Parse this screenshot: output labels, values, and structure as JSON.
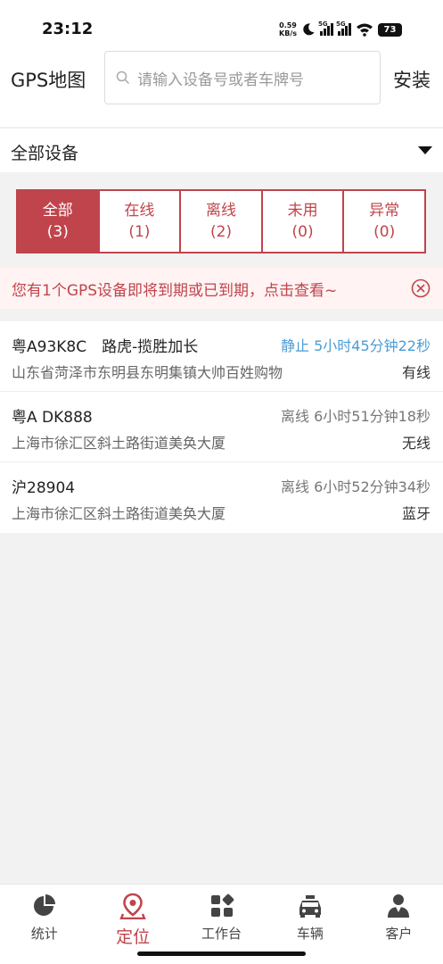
{
  "status_bar": {
    "time": "23:12",
    "net_speed_value": "0.59",
    "net_speed_unit": "KB/s",
    "signal_1": "5G",
    "signal_2": "5G",
    "battery": "73"
  },
  "header": {
    "title": "GPS地图",
    "search_placeholder": "请输入设备号或者车牌号",
    "install_label": "安装"
  },
  "device_filter": {
    "label": "全部设备"
  },
  "tabs": [
    {
      "label": "全部",
      "count": "(3)",
      "active": true
    },
    {
      "label": "在线",
      "count": "(1)",
      "active": false
    },
    {
      "label": "离线",
      "count": "(2)",
      "active": false
    },
    {
      "label": "未用",
      "count": "(0)",
      "active": false
    },
    {
      "label": "异常",
      "count": "(0)",
      "active": false
    }
  ],
  "notice": {
    "text": "您有1个GPS设备即将到期或已到期，点击查看~"
  },
  "devices": [
    {
      "plate": "粤A93K8C　路虎-揽胜加长",
      "status": "静止 5小时45分钟22秒",
      "address": "山东省菏泽市东明县东明集镇大帅百姓购物",
      "connection": "有线"
    },
    {
      "plate": "粤A DK888",
      "status": "离线 6小时51分钟18秒",
      "address": "上海市徐汇区斜土路街道美奂大厦",
      "connection": "无线"
    },
    {
      "plate": "沪28904",
      "status": "离线 6小时52分钟34秒",
      "address": "上海市徐汇区斜土路街道美奂大厦",
      "connection": "蓝牙"
    }
  ],
  "bottom_nav": [
    {
      "label": "统计",
      "icon": "pie-chart-icon"
    },
    {
      "label": "定位",
      "icon": "location-pin-icon"
    },
    {
      "label": "工作台",
      "icon": "workbench-icon"
    },
    {
      "label": "车辆",
      "icon": "car-icon"
    },
    {
      "label": "客户",
      "icon": "user-icon"
    }
  ],
  "colors": {
    "accent": "#c0444c",
    "stop_status": "#4a9cd6"
  }
}
